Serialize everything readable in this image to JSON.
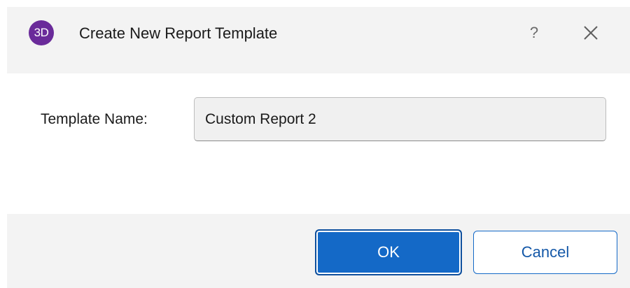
{
  "window": {
    "title": "Create New Report Template",
    "logo_text": "3D",
    "help_label": "?",
    "close_icon": "close-icon"
  },
  "form": {
    "template_name_label": "Template Name:",
    "template_name_value": "Custom Report 2"
  },
  "buttons": {
    "ok_label": "OK",
    "cancel_label": "Cancel"
  },
  "colors": {
    "brand_purple": "#6a2b9a",
    "primary_blue": "#1469c7",
    "panel_gray": "#f3f3f3"
  }
}
